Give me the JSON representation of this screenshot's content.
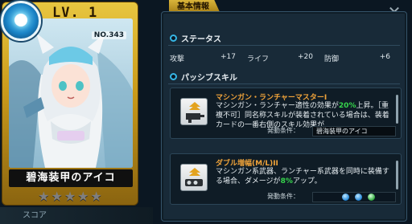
{
  "card": {
    "level": "LV.  1",
    "number": "NO.343",
    "name": "碧海装甲のアイコ",
    "stars": "★★★★★",
    "score_label": "スコア"
  },
  "panel": {
    "tab_label": "基本情報",
    "close_glyph": "✕",
    "status": {
      "heading": "ステータス",
      "stats": [
        {
          "label": "攻撃",
          "value": "+17"
        },
        {
          "label": "ライフ",
          "value": "+20"
        },
        {
          "label": "防御",
          "value": "+6"
        }
      ]
    },
    "passive": {
      "heading": "パッシブスキル",
      "skills": [
        {
          "name": "マシンガン・ランチャーマスターI",
          "desc_pre": "マシンガン・ランチャー適性の効果が",
          "desc_hl": "20%",
          "desc_post": "上昇。［重複不可］同名称スキルが装着されている場合は、装着カードの一番右側のスキル効果が",
          "cond_label": "発動条件：",
          "cond_value": "碧海装甲のアイコ"
        },
        {
          "name": "ダブル増幅(M/L)II",
          "desc_pre": "マシンガン系武器、ランチャー系武器を同時に装備する場合、ダメージが",
          "desc_hl": "8%",
          "desc_post": "アップ。",
          "cond_label": "発動条件：",
          "cond_orbs": [
            "blue",
            "blue",
            "green"
          ]
        }
      ]
    }
  },
  "colors": {
    "gold": "#d9b43a",
    "accent_blue": "#36b6e5",
    "skill_name": "#f0a33a",
    "highlight": "#36d44c"
  }
}
